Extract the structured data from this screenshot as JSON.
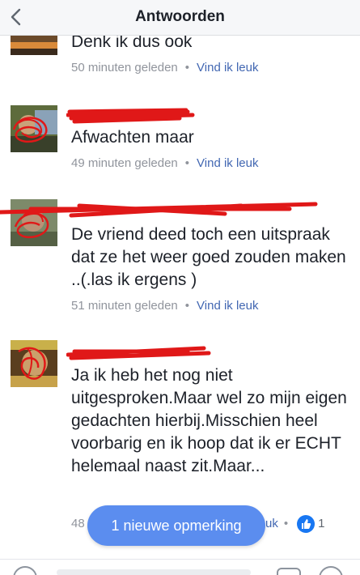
{
  "header": {
    "title": "Antwoorden",
    "back_icon": "chevron-left-icon"
  },
  "comments": [
    {
      "author": "",
      "text": "Denk ik dus ook",
      "time": "50 minuten geleden",
      "like_label": "Vind ik leuk"
    },
    {
      "author": "",
      "text": "Afwachten maar",
      "time": "49 minuten geleden",
      "like_label": "Vind ik leuk"
    },
    {
      "author": "",
      "text": "De vriend deed toch een uitspraak dat ze het weer goed zouden maken ..(.las ik ergens )",
      "time": "51 minuten geleden",
      "like_label": "Vind ik leuk"
    },
    {
      "author": "",
      "text": "Ja ik heb het nog niet uitgesproken.Maar wel zo mijn eigen gedachten hierbij.Misschien heel voorbarig en ik hoop dat ik er ECHT helemaal naast zit.Maar...",
      "time_partial": "48",
      "like_partial": "uk",
      "like_count": "1"
    }
  ],
  "toast": {
    "label": "1 nieuwe opmerking"
  },
  "colors": {
    "link": "#4267b2",
    "meta": "#90949c",
    "toast": "#5b8def",
    "redaction": "#e01818"
  }
}
